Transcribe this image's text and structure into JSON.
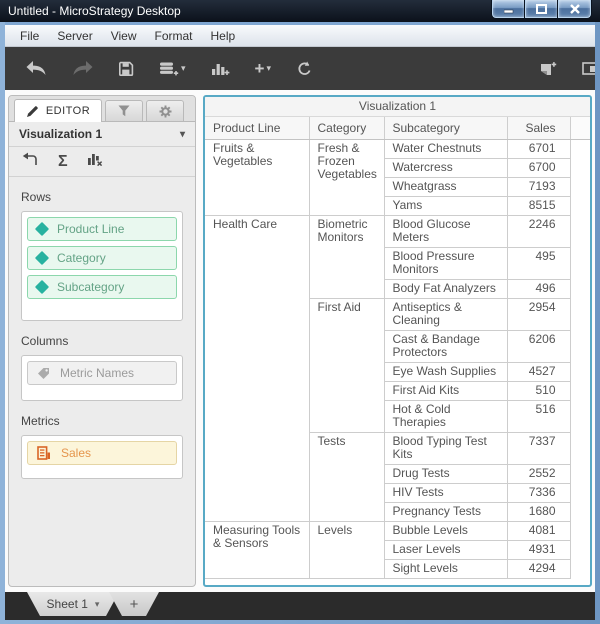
{
  "window": {
    "title": "Untitled - MicroStrategy Desktop"
  },
  "menubar": {
    "items": [
      "File",
      "Server",
      "View",
      "Format",
      "Help"
    ]
  },
  "toolbar": {
    "plus": "+",
    "caret": "▾"
  },
  "editor": {
    "tab_label": "EDITOR",
    "visualization_name": "Visualization 1",
    "sigma": "Σ",
    "caret": "▾",
    "rows_label": "Rows",
    "columns_label": "Columns",
    "metrics_label": "Metrics",
    "rows_items": [
      {
        "label": "Product Line"
      },
      {
        "label": "Category"
      },
      {
        "label": "Subcategory"
      }
    ],
    "columns_items": [
      {
        "label": "Metric Names"
      }
    ],
    "metrics_items": [
      {
        "label": "Sales"
      }
    ]
  },
  "visualization": {
    "title": "Visualization 1",
    "columns": [
      "Product Line",
      "Category",
      "Subcategory",
      "Sales"
    ],
    "groups": [
      {
        "product_line": "Fruits & Vegetables",
        "categories": [
          {
            "name": "Fresh & Frozen Vegetables",
            "items": [
              [
                "Water Chestnuts",
                6701
              ],
              [
                "Watercress",
                6700
              ],
              [
                "Wheatgrass",
                7193
              ],
              [
                "Yams",
                8515
              ]
            ]
          }
        ]
      },
      {
        "product_line": "Health Care",
        "categories": [
          {
            "name": "Biometric Monitors",
            "items": [
              [
                "Blood Glucose Meters",
                2246
              ],
              [
                "Blood Pressure Monitors",
                495
              ],
              [
                "Body Fat Analyzers",
                496
              ]
            ]
          },
          {
            "name": "First Aid",
            "items": [
              [
                "Antiseptics & Cleaning",
                2954
              ],
              [
                "Cast & Bandage Protectors",
                6206
              ],
              [
                "Eye Wash Supplies",
                4527
              ],
              [
                "First Aid Kits",
                510
              ],
              [
                "Hot & Cold Therapies",
                516
              ]
            ]
          },
          {
            "name": "Tests",
            "items": [
              [
                "Blood Typing Test Kits",
                7337
              ],
              [
                "Drug Tests",
                2552
              ],
              [
                "HIV Tests",
                7336
              ],
              [
                "Pregnancy Tests",
                1680
              ]
            ]
          }
        ]
      },
      {
        "product_line": "Measuring Tools & Sensors",
        "categories": [
          {
            "name": "Levels",
            "items": [
              [
                "Bubble Levels",
                4081
              ],
              [
                "Laser Levels",
                4931
              ],
              [
                "Sight Levels",
                4294
              ]
            ]
          }
        ]
      }
    ]
  },
  "sheetbar": {
    "sheet_label": "Sheet 1",
    "add_label": "+",
    "caret": "▾"
  },
  "colors": {
    "selection_border": "#58a9c5",
    "attribute_green": "#8cd7ac",
    "metric_orange": "#e5954d",
    "diamond_teal": "#28b2a0"
  }
}
